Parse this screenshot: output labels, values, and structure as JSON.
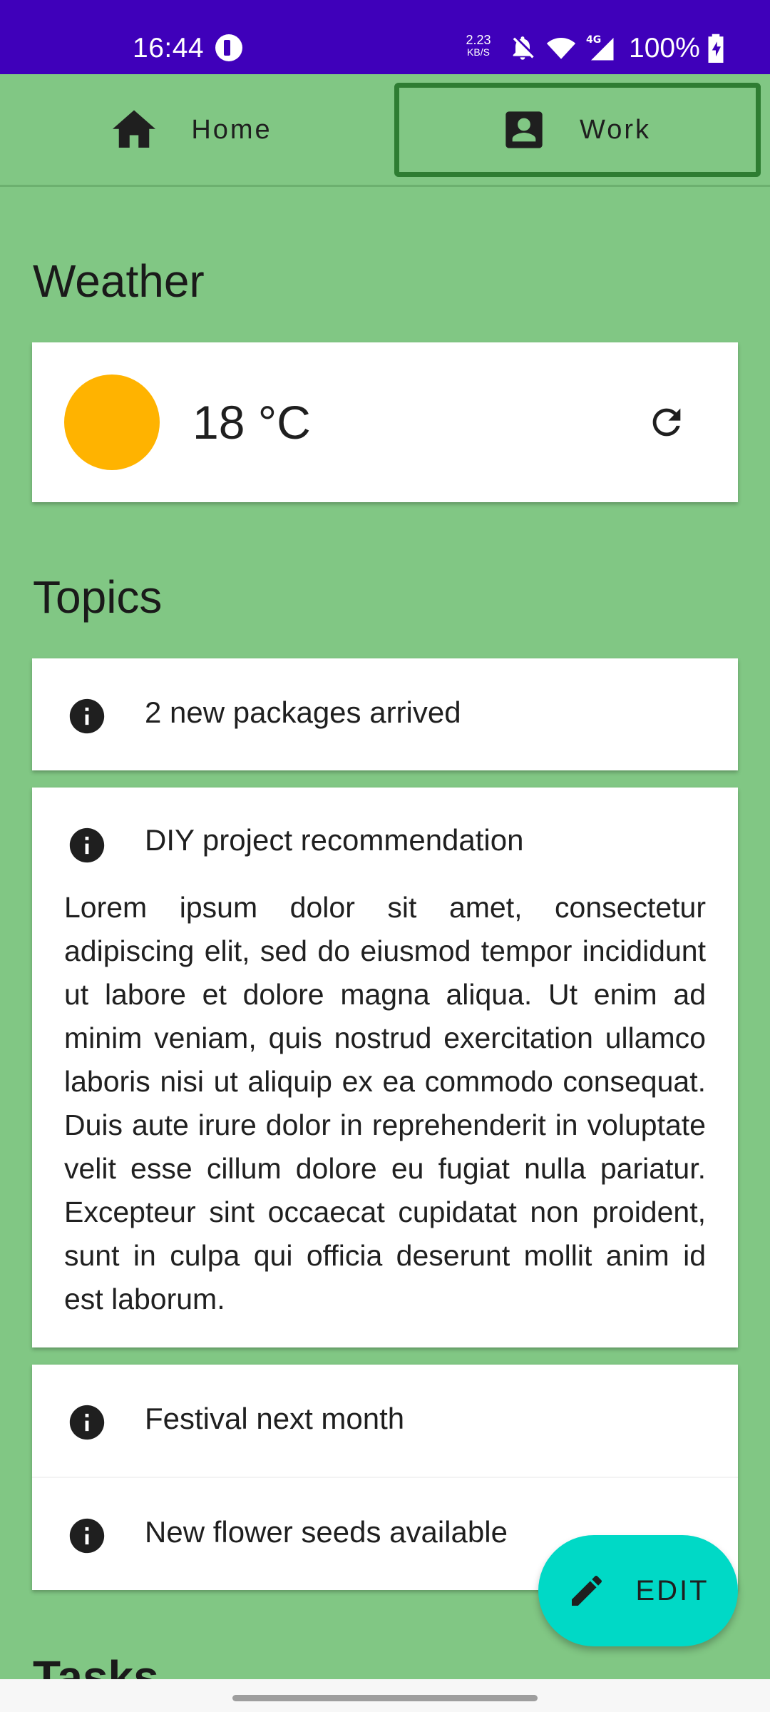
{
  "status_bar": {
    "time": "16:44",
    "net_speed_value": "2.23",
    "net_speed_unit": "KB/S",
    "battery_percent": "100%",
    "icons": [
      "app-indicator-icon",
      "bell-off-icon",
      "wifi-icon",
      "4g-signal-icon",
      "battery-charging-icon"
    ],
    "background_color": "#3F00BA"
  },
  "tabs": [
    {
      "label": "Home",
      "icon": "home-icon",
      "selected": false
    },
    {
      "label": "Work",
      "icon": "contact-card-icon",
      "selected": true
    }
  ],
  "weather": {
    "section_title": "Weather",
    "temperature": "18 °C",
    "sun_color": "#FFB300",
    "refresh_icon": "refresh-icon"
  },
  "topics": {
    "section_title": "Topics",
    "items": [
      {
        "title": "2 new packages arrived",
        "icon": "info-icon"
      },
      {
        "title": "DIY project recommendation",
        "icon": "info-icon",
        "body": "Lorem ipsum dolor sit amet, consectetur adipiscing elit, sed do eiusmod tempor incididunt ut labore et dolore magna aliqua. Ut enim ad minim veniam, quis nostrud exercitation ullamco laboris nisi ut aliquip ex ea commodo consequat. Duis aute irure dolor in reprehenderit in voluptate velit esse cillum dolore eu fugiat nulla pariatur. Excepteur sint occaecat cupidatat non proident, sunt in culpa qui officia deserunt mollit anim id est laborum."
      },
      {
        "title": "Festival next month",
        "icon": "info-icon"
      },
      {
        "title": "New flower seeds available",
        "icon": "info-icon"
      }
    ]
  },
  "fab": {
    "label": "EDIT",
    "icon": "pencil-icon",
    "color": "#00D9C6"
  },
  "next_section_title": "Tasks",
  "theme": {
    "background": "#81C784",
    "selected_tab_border": "#2E7D32"
  }
}
